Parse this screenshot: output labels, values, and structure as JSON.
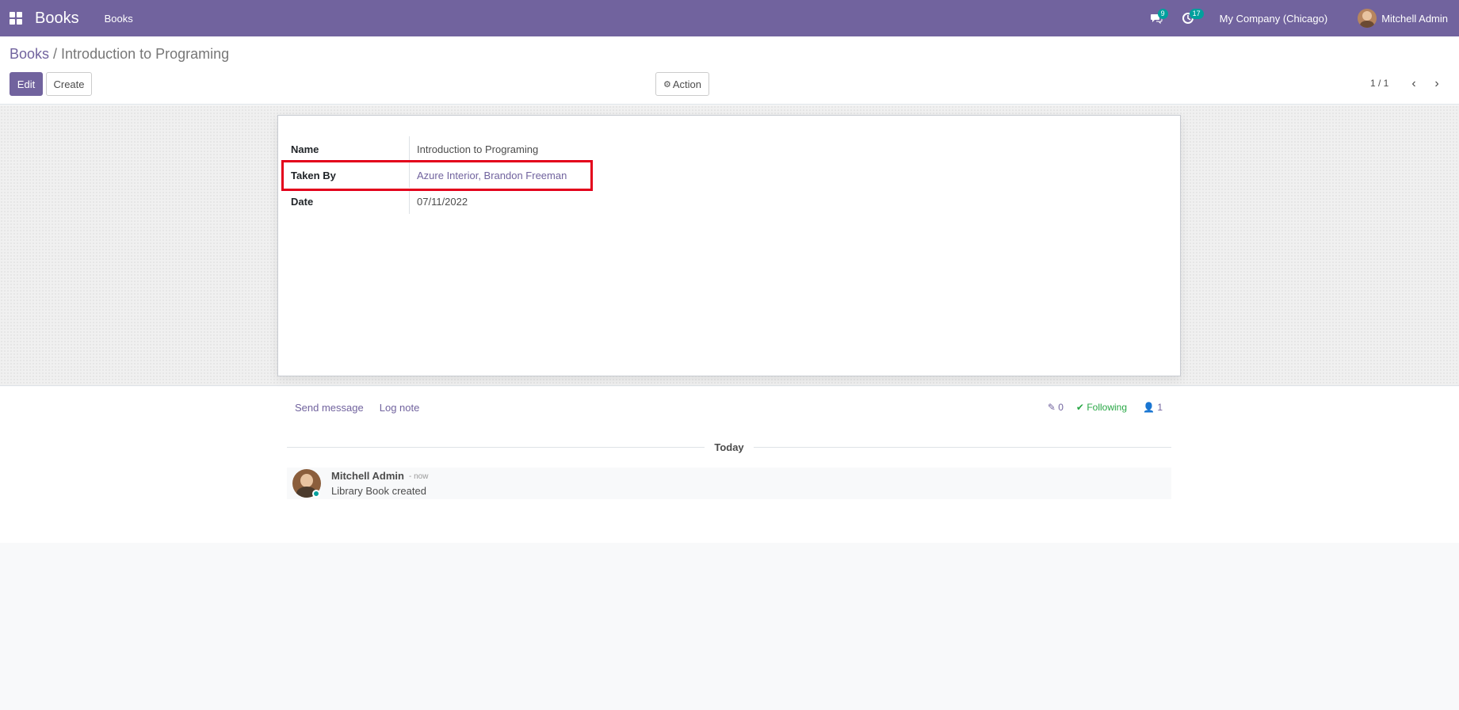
{
  "navbar": {
    "app_name": "Books",
    "menu_books": "Books",
    "messages_badge": "9",
    "activities_badge": "17",
    "company": "My Company (Chicago)",
    "user": "Mitchell Admin",
    "bg_color": "#71639e"
  },
  "control": {
    "breadcrumb_parent": "Books",
    "breadcrumb_sep": " / ",
    "breadcrumb_current": "Introduction to Programing",
    "edit_label": "Edit",
    "create_label": "Create",
    "action_label": "Action",
    "pager": "1 / 1"
  },
  "form": {
    "fields": [
      {
        "label": "Name",
        "value": "Introduction to Programing"
      },
      {
        "label": "Taken By",
        "value": "Azure Interior, Brandon Freeman"
      },
      {
        "label": "Date",
        "value": "07/11/2022"
      }
    ]
  },
  "chatter": {
    "send_message": "Send message",
    "log_note": "Log note",
    "attachments_count": "0",
    "following": "Following",
    "followers_count": "1",
    "date_separator": "Today",
    "messages": [
      {
        "author": "Mitchell Admin",
        "time": "- now",
        "body": "Library Book created"
      }
    ]
  },
  "icons": {
    "apps": "apps-grid-icon",
    "messages": "chat-icon",
    "activities": "clock-icon",
    "action": "gear-icon",
    "pager_prev": "chevron-left-icon",
    "pager_next": "chevron-right-icon",
    "attachment": "paperclip-icon",
    "following": "check-icon",
    "followers": "user-icon"
  }
}
